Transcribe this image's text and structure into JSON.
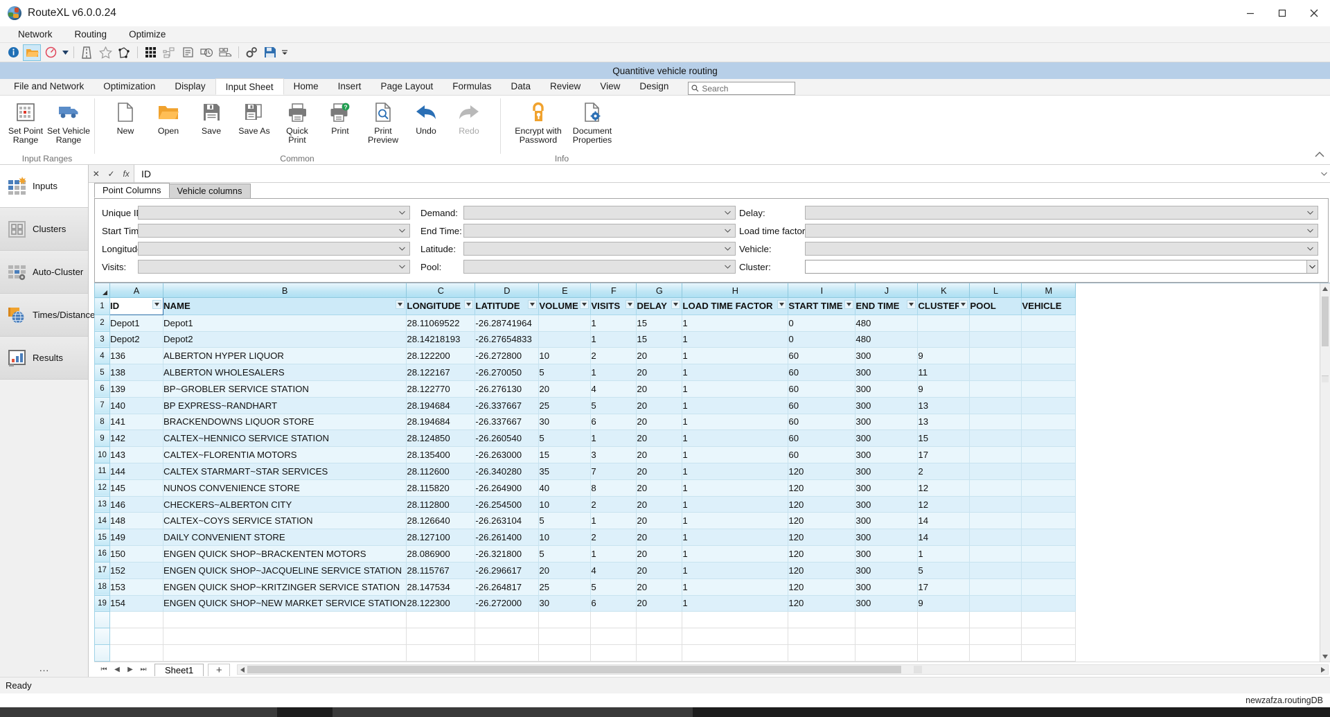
{
  "window": {
    "title": "RouteXL v6.0.0.24",
    "minimize": "minimize-button",
    "maximize": "maximize-button",
    "close": "close-button"
  },
  "menubar": {
    "items": [
      "Network",
      "Routing",
      "Optimize"
    ]
  },
  "quick_toolbar": {
    "items": [
      {
        "name": "info-icon",
        "label": "Info"
      },
      {
        "name": "open-folder-icon",
        "label": "Open"
      },
      {
        "name": "compass-icon",
        "label": "Compass"
      },
      {
        "name": "dropdown-caret-icon",
        "label": "More"
      },
      {
        "name": "highway-icon",
        "label": "Highway"
      },
      {
        "name": "star-icon",
        "label": "Star"
      },
      {
        "name": "polygon-icon",
        "label": "Polygon"
      },
      {
        "name": "grid-matrix-icon",
        "label": "Matrix"
      },
      {
        "name": "network-nodes-icon",
        "label": "Network"
      },
      {
        "name": "document-list-icon",
        "label": "List"
      },
      {
        "name": "truck-clock-icon",
        "label": "Schedule"
      },
      {
        "name": "truck-fleet-icon",
        "label": "Fleet"
      },
      {
        "name": "settings-gears-icon",
        "label": "Settings"
      },
      {
        "name": "save-disk-icon",
        "label": "Save"
      },
      {
        "name": "overflow-caret-icon",
        "label": "Customize"
      }
    ]
  },
  "document_banner": {
    "title": "Quantitive vehicle routing"
  },
  "ribbon": {
    "tabs": [
      {
        "label": "File and Network",
        "active": false
      },
      {
        "label": "Optimization",
        "active": false
      },
      {
        "label": "Display",
        "active": false
      },
      {
        "label": "Input Sheet",
        "active": true
      },
      {
        "label": "Home",
        "active": false
      },
      {
        "label": "Insert",
        "active": false
      },
      {
        "label": "Page Layout",
        "active": false
      },
      {
        "label": "Formulas",
        "active": false
      },
      {
        "label": "Data",
        "active": false
      },
      {
        "label": "Review",
        "active": false
      },
      {
        "label": "View",
        "active": false
      },
      {
        "label": "Design",
        "active": false
      }
    ],
    "search": {
      "placeholder": "Search",
      "value": ""
    },
    "groups": [
      {
        "title": "Input Ranges",
        "buttons": [
          {
            "label": "Set Point\nRange",
            "icon": "grid-point-range-icon",
            "disabled": false
          },
          {
            "label": "Set Vehicle\nRange",
            "icon": "truck-icon",
            "disabled": false
          }
        ]
      },
      {
        "title": "Common",
        "buttons": [
          {
            "label": "New",
            "icon": "new-document-icon",
            "disabled": false
          },
          {
            "label": "Open",
            "icon": "open-folder-icon",
            "disabled": false
          },
          {
            "label": "Save",
            "icon": "save-floppy-icon",
            "disabled": false
          },
          {
            "label": "Save As",
            "icon": "save-as-icon",
            "disabled": false
          },
          {
            "label": "Quick\nPrint",
            "icon": "quick-print-icon",
            "disabled": false
          },
          {
            "label": "Print",
            "icon": "print-help-icon",
            "disabled": false
          },
          {
            "label": "Print\nPreview",
            "icon": "print-preview-icon",
            "disabled": false
          },
          {
            "label": "Undo",
            "icon": "undo-arrow-icon",
            "disabled": false
          },
          {
            "label": "Redo",
            "icon": "redo-arrow-icon",
            "disabled": true
          }
        ]
      },
      {
        "title": "Info",
        "buttons": [
          {
            "label": "Encrypt with\nPassword",
            "icon": "lock-key-icon",
            "disabled": false
          },
          {
            "label": "Document\nProperties",
            "icon": "document-gear-icon",
            "disabled": false
          }
        ]
      }
    ]
  },
  "sidebar": {
    "items": [
      {
        "label": "Inputs",
        "icon": "inputs-grid-icon",
        "active": true
      },
      {
        "label": "Clusters",
        "icon": "clusters-squares-icon",
        "active": false
      },
      {
        "label": "Auto-Cluster",
        "icon": "auto-cluster-gear-icon",
        "active": false
      },
      {
        "label": "Times/Distances",
        "icon": "times-distances-globe-icon",
        "active": false
      },
      {
        "label": "Results",
        "icon": "results-bar-chart-icon",
        "active": false
      }
    ],
    "overflow": "…"
  },
  "formula_bar": {
    "cancel": "✕",
    "accept": "✓",
    "function": "fx",
    "value": "ID"
  },
  "mapping": {
    "tabs": [
      {
        "label": "Point Columns",
        "active": true
      },
      {
        "label": "Vehicle columns",
        "active": false
      }
    ],
    "fields": [
      {
        "label": "Unique ID:",
        "value": "",
        "col": 0
      },
      {
        "label": "Demand:",
        "value": "",
        "col": 1
      },
      {
        "label": "Delay:",
        "value": "",
        "col": 2
      },
      {
        "label": "Start Time:",
        "value": "",
        "col": 0
      },
      {
        "label": "End Time:",
        "value": "",
        "col": 1
      },
      {
        "label": "Load time factor:",
        "value": "",
        "col": 2
      },
      {
        "label": "Longitude:",
        "value": "",
        "col": 0
      },
      {
        "label": "Latitude:",
        "value": "",
        "col": 1
      },
      {
        "label": "Vehicle:",
        "value": "",
        "col": 2
      },
      {
        "label": "Visits:",
        "value": "",
        "col": 0
      },
      {
        "label": "Pool:",
        "value": "",
        "col": 1
      },
      {
        "label": "Cluster:",
        "value": "",
        "col": 2
      }
    ]
  },
  "sheet": {
    "column_letters": [
      "A",
      "B",
      "C",
      "D",
      "E",
      "F",
      "G",
      "H",
      "I",
      "J",
      "K",
      "L",
      "M"
    ],
    "headers": [
      "ID",
      "NAME",
      "LONGITUDE",
      "LATITUDE",
      "VOLUME",
      "VISITS",
      "DELAY",
      "LOAD TIME FACTOR",
      "START TIME",
      "END TIME",
      "CLUSTER",
      "POOL",
      "VEHICLE"
    ],
    "selected_cell": "A1",
    "rows": [
      {
        "n": 1,
        "header": true,
        "cells": [
          "ID",
          "NAME",
          "LONGITUDE",
          "LATITUDE",
          "VOLUME",
          "VISITS",
          "DELAY",
          "LOAD TIME FACTOR",
          "START TIME",
          "END TIME",
          "CLUSTER",
          "POOL",
          "VEHICLE"
        ]
      },
      {
        "n": 2,
        "cells": [
          "Depot1",
          "Depot1",
          "28.11069522",
          "-26.28741964",
          "",
          "1",
          "15",
          "1",
          "0",
          "480",
          "",
          "",
          ""
        ]
      },
      {
        "n": 3,
        "cells": [
          "Depot2",
          "Depot2",
          "28.14218193",
          "-26.27654833",
          "",
          "1",
          "15",
          "1",
          "0",
          "480",
          "",
          "",
          ""
        ]
      },
      {
        "n": 4,
        "cells": [
          "136",
          "ALBERTON HYPER LIQUOR",
          "28.122200",
          "-26.272800",
          "10",
          "2",
          "20",
          "1",
          "60",
          "300",
          "9",
          "",
          ""
        ]
      },
      {
        "n": 5,
        "cells": [
          "138",
          "ALBERTON WHOLESALERS",
          "28.122167",
          "-26.270050",
          "5",
          "1",
          "20",
          "1",
          "60",
          "300",
          "11",
          "",
          ""
        ]
      },
      {
        "n": 6,
        "cells": [
          "139",
          "BP~GROBLER SERVICE STATION",
          "28.122770",
          "-26.276130",
          "20",
          "4",
          "20",
          "1",
          "60",
          "300",
          "9",
          "",
          ""
        ]
      },
      {
        "n": 7,
        "cells": [
          "140",
          "BP EXPRESS~RANDHART",
          "28.194684",
          "-26.337667",
          "25",
          "5",
          "20",
          "1",
          "60",
          "300",
          "13",
          "",
          ""
        ]
      },
      {
        "n": 8,
        "cells": [
          "141",
          "BRACKENDOWNS LIQUOR STORE",
          "28.194684",
          "-26.337667",
          "30",
          "6",
          "20",
          "1",
          "60",
          "300",
          "13",
          "",
          ""
        ]
      },
      {
        "n": 9,
        "cells": [
          "142",
          "CALTEX~HENNICO SERVICE STATION",
          "28.124850",
          "-26.260540",
          "5",
          "1",
          "20",
          "1",
          "60",
          "300",
          "15",
          "",
          ""
        ]
      },
      {
        "n": 10,
        "cells": [
          "143",
          "CALTEX~FLORENTIA MOTORS",
          "28.135400",
          "-26.263000",
          "15",
          "3",
          "20",
          "1",
          "60",
          "300",
          "17",
          "",
          ""
        ]
      },
      {
        "n": 11,
        "cells": [
          "144",
          "CALTEX STARMART~STAR SERVICES",
          "28.112600",
          "-26.340280",
          "35",
          "7",
          "20",
          "1",
          "120",
          "300",
          "2",
          "",
          ""
        ]
      },
      {
        "n": 12,
        "cells": [
          "145",
          "NUNOS CONVENIENCE STORE",
          "28.115820",
          "-26.264900",
          "40",
          "8",
          "20",
          "1",
          "120",
          "300",
          "12",
          "",
          ""
        ]
      },
      {
        "n": 13,
        "cells": [
          "146",
          "CHECKERS~ALBERTON CITY",
          "28.112800",
          "-26.254500",
          "10",
          "2",
          "20",
          "1",
          "120",
          "300",
          "12",
          "",
          ""
        ]
      },
      {
        "n": 14,
        "cells": [
          "148",
          "CALTEX~COYS SERVICE STATION",
          "28.126640",
          "-26.263104",
          "5",
          "1",
          "20",
          "1",
          "120",
          "300",
          "14",
          "",
          ""
        ]
      },
      {
        "n": 15,
        "cells": [
          "149",
          "DAILY CONVENIENT STORE",
          "28.127100",
          "-26.261400",
          "10",
          "2",
          "20",
          "1",
          "120",
          "300",
          "14",
          "",
          ""
        ]
      },
      {
        "n": 16,
        "cells": [
          "150",
          "ENGEN QUICK SHOP~BRACKENTEN MOTORS",
          "28.086900",
          "-26.321800",
          "5",
          "1",
          "20",
          "1",
          "120",
          "300",
          "1",
          "",
          ""
        ]
      },
      {
        "n": 17,
        "cells": [
          "152",
          "ENGEN QUICK SHOP~JACQUELINE SERVICE STATION",
          "28.115767",
          "-26.296617",
          "20",
          "4",
          "20",
          "1",
          "120",
          "300",
          "5",
          "",
          ""
        ]
      },
      {
        "n": 18,
        "cells": [
          "153",
          "ENGEN QUICK SHOP~KRITZINGER SERVICE STATION",
          "28.147534",
          "-26.264817",
          "25",
          "5",
          "20",
          "1",
          "120",
          "300",
          "17",
          "",
          ""
        ]
      },
      {
        "n": 19,
        "cells": [
          "154",
          "ENGEN QUICK SHOP~NEW MARKET SERVICE STATION",
          "28.122300",
          "-26.272000",
          "30",
          "6",
          "20",
          "1",
          "120",
          "300",
          "9",
          "",
          ""
        ]
      }
    ],
    "bottom": {
      "sheet_tab": "Sheet1",
      "add_sheet": "+",
      "first": "⏮",
      "prev": "◀",
      "next": "▶",
      "last": "⏭"
    }
  },
  "status": {
    "text": "Ready",
    "database": "newzafza.routingDB"
  },
  "colors": {
    "accent_blue": "#b7cfe8",
    "header_cell": "#cdeaf8",
    "row_band": "#e9f6fc",
    "orange": "#f0a22e",
    "blue_icon": "#4a7ebb"
  }
}
